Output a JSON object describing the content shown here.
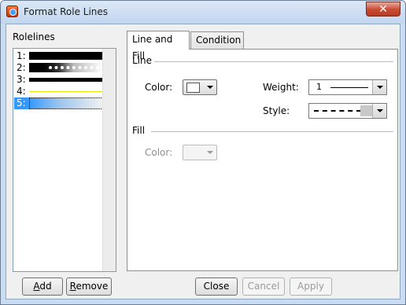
{
  "window": {
    "title": "Format Role Lines",
    "close_glyph": "✕"
  },
  "rolelines": {
    "label": "Rolelines",
    "items": [
      {
        "num": "1:",
        "style": "solid-thick",
        "selected": false
      },
      {
        "num": "2:",
        "style": "dotted-white",
        "selected": false
      },
      {
        "num": "3:",
        "style": "solid-medium",
        "selected": false
      },
      {
        "num": "4:",
        "style": "yellow-thin",
        "selected": false
      },
      {
        "num": "5:",
        "style": "dashed-gray",
        "selected": true
      }
    ]
  },
  "tabs": [
    {
      "label": "Line and Fill",
      "active": true
    },
    {
      "label": "Condition",
      "active": false
    }
  ],
  "line_group": {
    "label": "Line",
    "color_label": "Color:",
    "color_value": "#ffffff",
    "weight_label": "Weight:",
    "weight_value": "1",
    "style_label": "Style:",
    "style_value": "dashed"
  },
  "fill_group": {
    "label": "Fill",
    "color_label": "Color:"
  },
  "buttons": {
    "add": {
      "mnemonic": "A",
      "rest": "dd"
    },
    "remove": {
      "mnemonic": "R",
      "rest": "emove"
    },
    "close": "Close",
    "cancel": "Cancel",
    "apply": "Apply"
  }
}
